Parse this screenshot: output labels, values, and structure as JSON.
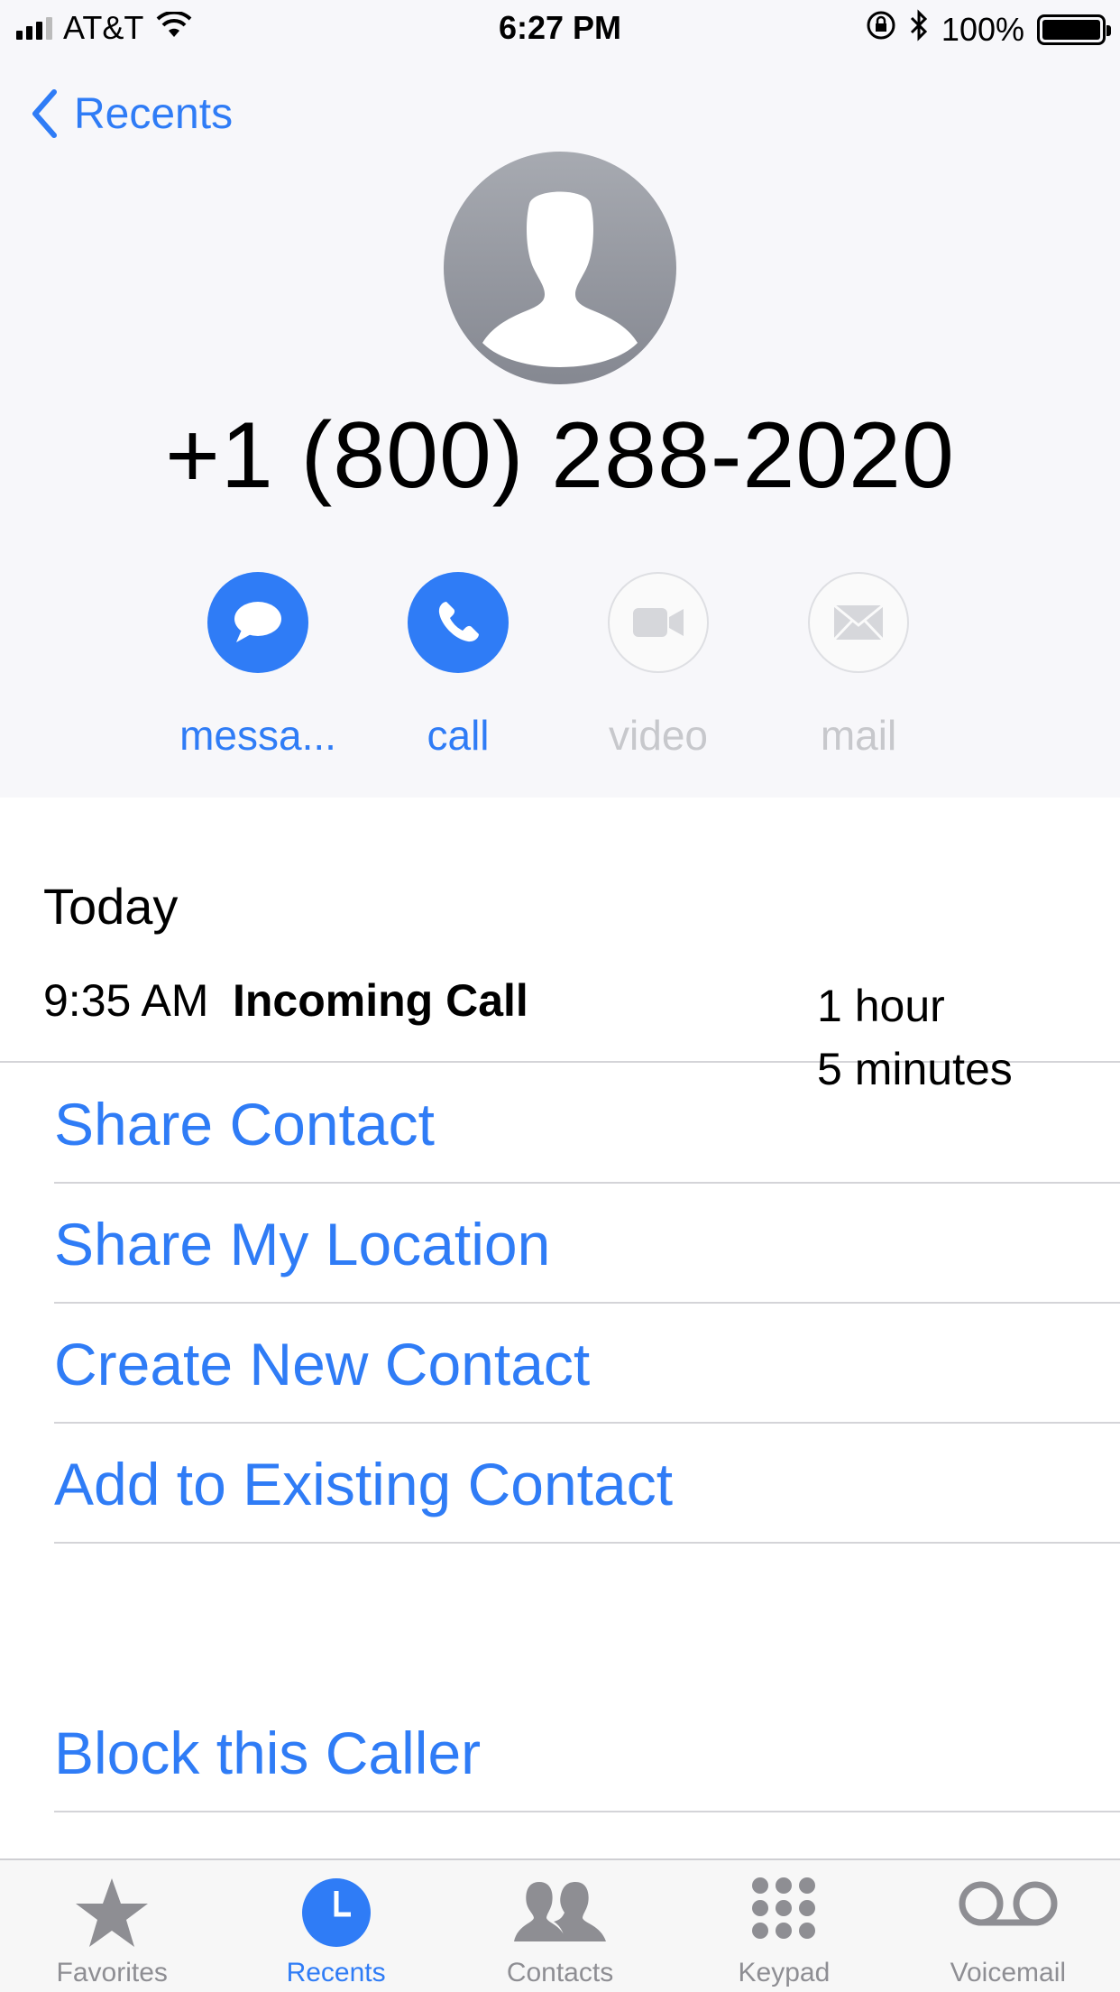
{
  "status_bar": {
    "carrier": "AT&T",
    "time": "6:27 PM",
    "battery": "100%"
  },
  "nav": {
    "back_label": "Recents"
  },
  "contact": {
    "phone_number": "+1 (800) 288-2020"
  },
  "actions": [
    {
      "label": "messa...",
      "icon": "message-bubble-icon",
      "enabled": true
    },
    {
      "label": "call",
      "icon": "phone-icon",
      "enabled": true
    },
    {
      "label": "video",
      "icon": "video-camera-icon",
      "enabled": false
    },
    {
      "label": "mail",
      "icon": "envelope-icon",
      "enabled": false
    }
  ],
  "history": {
    "section": "Today",
    "calls": [
      {
        "time": "9:35 AM",
        "type": "Incoming Call",
        "duration_line1": "1 hour",
        "duration_line2": "5 minutes"
      }
    ]
  },
  "options": [
    "Share Contact",
    "Share My Location",
    "Create New Contact",
    "Add to Existing Contact",
    "Block this Caller"
  ],
  "tab_bar": {
    "tabs": [
      {
        "label": "Favorites",
        "icon": "star-icon",
        "active": false
      },
      {
        "label": "Recents",
        "icon": "clock-icon",
        "active": true
      },
      {
        "label": "Contacts",
        "icon": "contacts-icon",
        "active": false
      },
      {
        "label": "Keypad",
        "icon": "keypad-icon",
        "active": false
      },
      {
        "label": "Voicemail",
        "icon": "voicemail-icon",
        "active": false
      }
    ]
  },
  "colors": {
    "accent": "#2f7cf6",
    "disabled": "#c7c8cc",
    "header_bg": "#f7f7fa"
  }
}
